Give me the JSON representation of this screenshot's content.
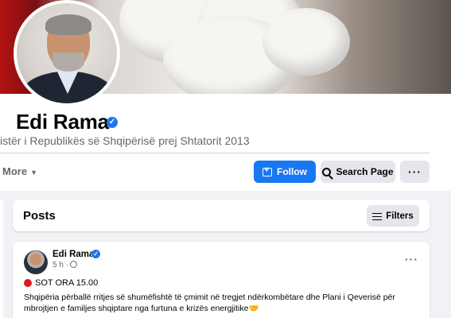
{
  "profile": {
    "name": "Edi Rama",
    "verified_glyph": "✓",
    "subtitle": "istër i Republikës së Shqipërisë prej Shtatorit 2013"
  },
  "tabs": {
    "more_label": "More",
    "more_caret": "▼"
  },
  "actions": {
    "follow_label": "Follow",
    "search_label": "Search Page",
    "dots_label": "···",
    "accent_color": "#1877f2"
  },
  "posts": {
    "title": "Posts",
    "filters_label": "Filters"
  },
  "post": {
    "author": "Edi Rama",
    "verified_glyph": "✓",
    "time": "5 h ·",
    "dots_label": "···",
    "headline": "SOT ORA 15.00",
    "text": "Shqipëria përballë rritjes së shumëfishtë të çmimit në tregjet ndërkombëtare dhe Plani i Qeverisë për mbrojtjen e familjes shqiptare nga furtuna e krizës energjitike🤝"
  },
  "icons": [
    "verified-badge-icon",
    "follow-icon",
    "search-icon",
    "more-dots-icon",
    "filter-icon",
    "globe-icon",
    "red-circle-icon"
  ]
}
